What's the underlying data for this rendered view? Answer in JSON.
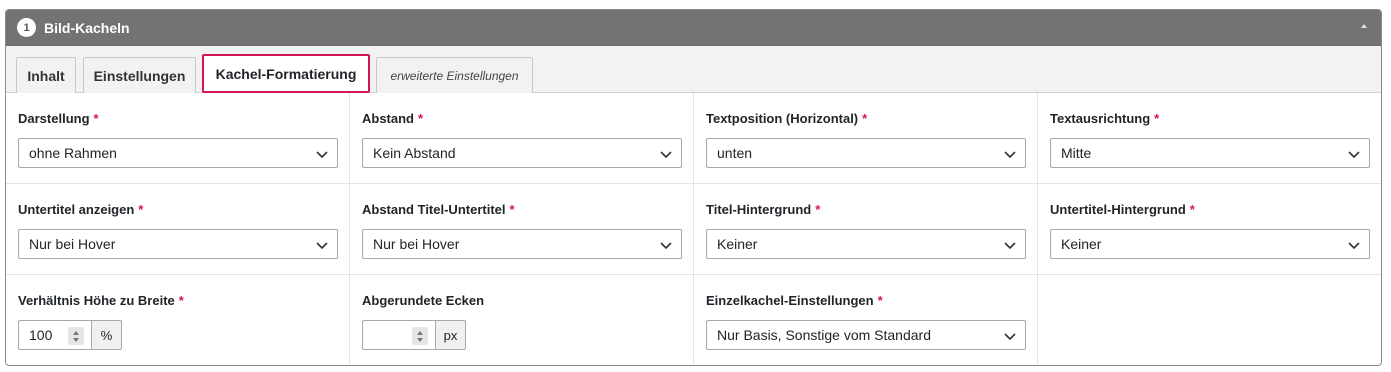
{
  "panel": {
    "number": "1",
    "title": "Bild-Kacheln"
  },
  "tabs": [
    {
      "label": "Inhalt"
    },
    {
      "label": "Einstellungen"
    },
    {
      "label": "Kachel-Formatierung"
    },
    {
      "label": "erweiterte Einstellungen"
    }
  ],
  "required_marker": "*",
  "fields": {
    "darstellung": {
      "label": "Darstellung",
      "value": "ohne Rahmen"
    },
    "abstand": {
      "label": "Abstand",
      "value": "Kein Abstand"
    },
    "textposition": {
      "label": "Textposition (Horizontal)",
      "value": "unten"
    },
    "textausrichtung": {
      "label": "Textausrichtung",
      "value": "Mitte"
    },
    "untertitel_anzeigen": {
      "label": "Untertitel anzeigen",
      "value": "Nur bei Hover"
    },
    "abstand_titel": {
      "label": "Abstand Titel-Untertitel",
      "value": "Nur bei Hover"
    },
    "titel_hintergrund": {
      "label": "Titel-Hintergrund",
      "value": "Keiner"
    },
    "untertitel_hintergrund": {
      "label": "Untertitel-Hintergrund",
      "value": "Keiner"
    },
    "verhaeltnis": {
      "label": "Verhältnis Höhe zu Breite",
      "value": "100",
      "unit": "%"
    },
    "ecken": {
      "label": "Abgerundete Ecken",
      "value": "",
      "unit": "px"
    },
    "einzelkachel": {
      "label": "Einzelkachel-Einstellungen",
      "value": "Nur Basis, Sonstige vom Standard"
    }
  }
}
